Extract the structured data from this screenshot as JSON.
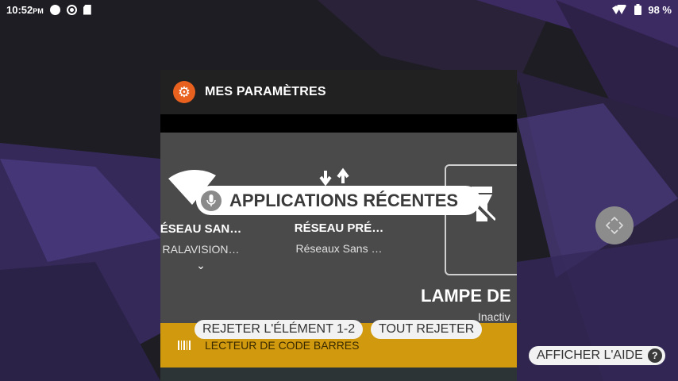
{
  "status_bar": {
    "time": "10:52",
    "ampm": "PM",
    "battery": "98 %"
  },
  "card": {
    "app_title": "MES PARAMÈTRES",
    "app_icon": "settings-gear-icon",
    "accent_color": "#e8611f",
    "tiles": [
      {
        "title": "ÉSEAU SAN…",
        "subtitle": "RALAVISION…"
      },
      {
        "title": "RÉSEAU PRÉ…",
        "subtitle": "Réseaux Sans …"
      },
      {
        "title": "LAMPE DE",
        "subtitle": "Inactiv"
      }
    ],
    "barcode_label": "LECTEUR DE CODE BARRES",
    "barcode_color": "#d19a0e"
  },
  "overlay": {
    "recents_label": "APPLICATIONS RÉCENTES",
    "dismiss_item": "REJETER L'ÉLÉMENT 1-2",
    "dismiss_all": "TOUT REJETER",
    "show_help": "AFFICHER L'AIDE",
    "help_glyph": "?"
  }
}
